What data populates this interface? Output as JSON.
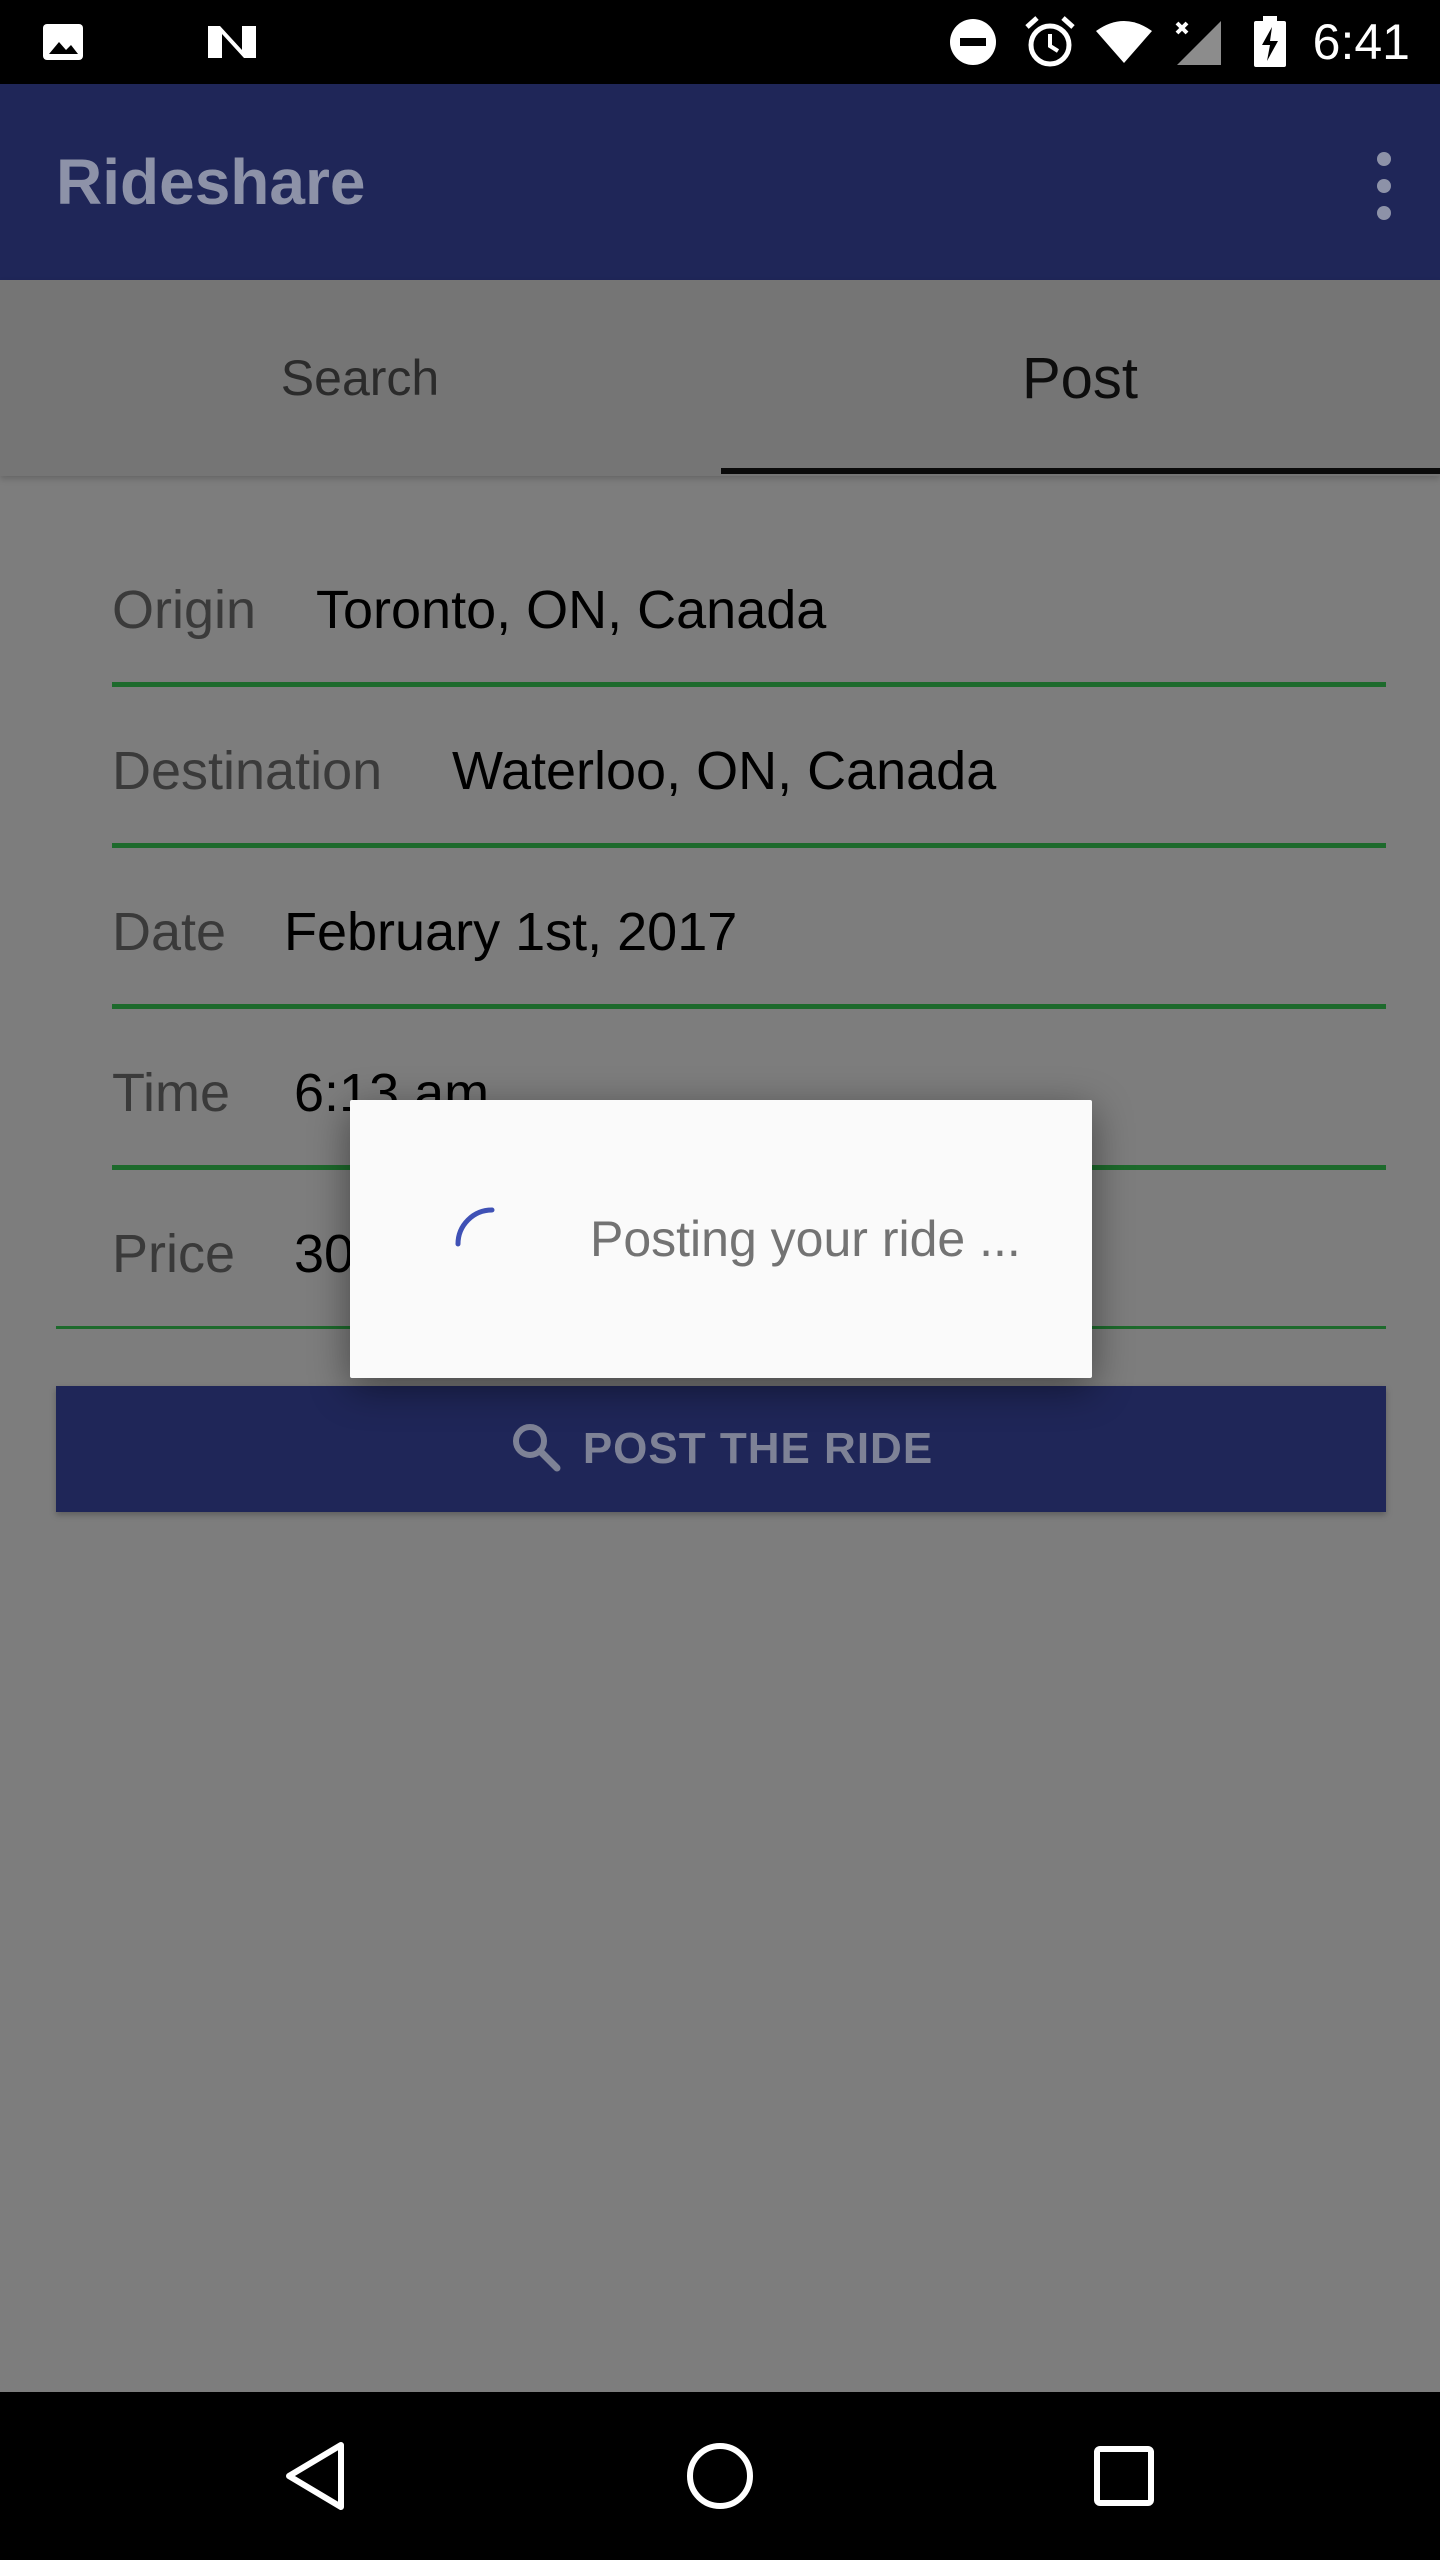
{
  "status_bar": {
    "time": "6:41",
    "icons": [
      "image-icon",
      "n-logo-icon",
      "do-not-disturb-icon",
      "alarm-icon",
      "wifi-icon",
      "signal-icon",
      "battery-charging-icon"
    ]
  },
  "app_bar": {
    "title": "Rideshare",
    "menu_icon": "more-vert-icon"
  },
  "tabs": [
    {
      "label": "Search",
      "selected": false
    },
    {
      "label": "Post",
      "selected": true
    }
  ],
  "form": {
    "origin": {
      "label": "Origin",
      "value": "Toronto, ON, Canada"
    },
    "destination": {
      "label": "Destination",
      "value": "Waterloo, ON, Canada"
    },
    "date": {
      "label": "Date",
      "value": "February 1st, 2017"
    },
    "time": {
      "label": "Time",
      "value": "6:13 am"
    },
    "price": {
      "label": "Price",
      "value": "30"
    }
  },
  "post_button": {
    "label": "POST THE RIDE",
    "icon": "search-icon"
  },
  "dialog": {
    "message": "Posting your ride ..."
  },
  "nav_bar": {
    "icons": [
      "back-icon",
      "home-icon",
      "recents-icon"
    ]
  },
  "colors": {
    "primary": "#1f2658",
    "field_underline": "#1d6a2c",
    "spinner": "#3f51b5"
  }
}
